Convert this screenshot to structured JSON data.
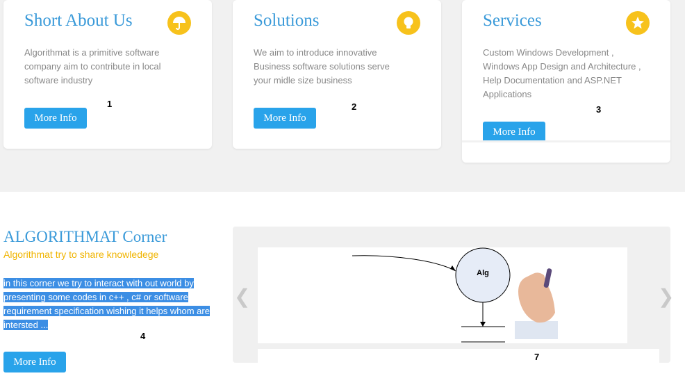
{
  "cards": [
    {
      "title": "Short About Us",
      "icon": "umbrella-icon",
      "text": "Algorithmat is a primitive software company aim to contribute in local software industry",
      "button": "More Info",
      "marker": "1"
    },
    {
      "title": "Solutions",
      "icon": "lightbulb-icon",
      "text": "We aim to introduce innovative Business software solutions serve your midle size business",
      "button": "More Info",
      "marker": "2"
    },
    {
      "title": "Services",
      "icon": "star-icon",
      "text": "Custom Windows Development , Windows App Design and Architecture , Help Documentation and ASP.NET Applications",
      "button": "More Info",
      "marker": "3"
    }
  ],
  "corner": {
    "title": "ALGORITHMAT Corner",
    "subtitle": "Algorithmat try to share knowledege",
    "text": "in this corner we try to interact with out world by presenting some codes in c++ , c# or software requirement specification wishing it helps whom are intersted ...",
    "button": "More Info",
    "marker": "4"
  },
  "slider": {
    "diagram_label": "Alg",
    "marker": "7"
  },
  "colors": {
    "accent": "#29a3ea",
    "title": "#3a9ad9",
    "icon_bg": "#f7c21c",
    "highlight": "#3c8ee4"
  }
}
